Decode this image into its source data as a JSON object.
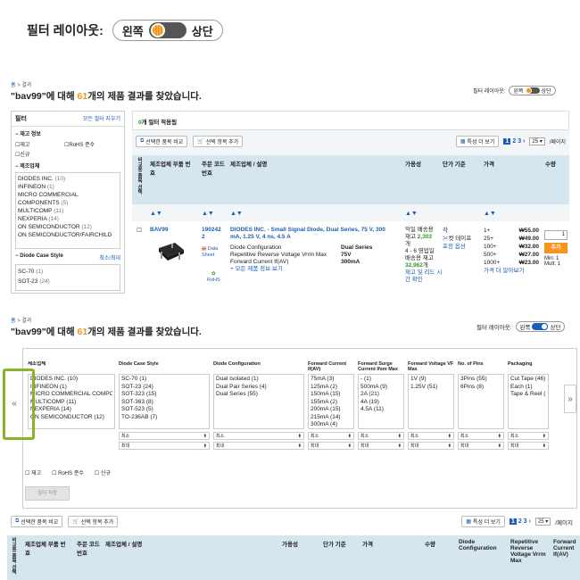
{
  "top_toggle": {
    "label": "필터 레이아웃:",
    "left": "왼쪽",
    "right": "상단"
  },
  "section1": {
    "breadcrumb": {
      "home": "홈",
      "sep": ">",
      "current": "결과"
    },
    "heading": {
      "pre": "\"bav99\"에 대해 ",
      "count": "61",
      "post": "개의 제품 결과를 찾았습니다."
    },
    "layout_toggle": {
      "label": "필터 레이아웃:",
      "left": "왼쪽",
      "right": "상단"
    },
    "filter_panel": {
      "title": "필터",
      "clear_all": "모든 필터 지우기",
      "stock_title": "재고 정보",
      "checks": [
        "재고",
        "RoHS 준수",
        "신규"
      ],
      "mfr_title": "제조업체",
      "manufacturers": [
        {
          "name": "DIODES INC.",
          "count": "(10)"
        },
        {
          "name": "INFINEON",
          "count": "(1)"
        },
        {
          "name": "MICRO COMMERCIAL COMPONENTS",
          "count": "(5)"
        },
        {
          "name": "MULTICOMP",
          "count": "(11)"
        },
        {
          "name": "NEXPERIA",
          "count": "(14)"
        },
        {
          "name": "ON SEMICONDUCTOR",
          "count": "(12)"
        },
        {
          "name": "ON SEMICONDUCTOR/FAIRCHILD",
          "count": ""
        }
      ],
      "case_title": "Diode Case Style",
      "case_minmax": "최소/최대",
      "cases": [
        {
          "name": "SC-70",
          "count": "(1)"
        },
        {
          "name": "SOT-23",
          "count": "(24)"
        }
      ]
    },
    "applied": {
      "count": "0",
      "text": "개 필터 적용됨"
    },
    "compare_btn": "선택한 품목 비교",
    "cart_btn": "선택 항목 추가",
    "more_attr_btn": "특성 더 보기",
    "pages": [
      "1",
      "2",
      "3"
    ],
    "next": "›",
    "per_page": "25",
    "per_page_suffix": "/페이지",
    "cols": {
      "compare": "비교용 품목 선택",
      "mfr_part": "제조업체 부품 번호",
      "order_code": "주문 코드 번호",
      "mfr_desc": "제조업체 / 설명",
      "availability": "가용성",
      "price_basis": "단가 기준",
      "price": "가격",
      "qty": "수량"
    },
    "product": {
      "part": "BAV99",
      "order": "1902422",
      "datasheet": "Data Sheet",
      "rohs": "RoHS",
      "title": "DIODES INC. - Small Signal Diode, Dual Series, 75 V, 300 mA, 1.25 V, 4 ns, 4.5 A",
      "specs": [
        {
          "k": "Diode Configuration",
          "v": "Dual Series"
        },
        {
          "k": "Repetitive Reverse Voltage Vrrm Max",
          "v": "75V"
        },
        {
          "k": "Forward Current If(AV)",
          "v": "300mA"
        }
      ],
      "more_specs": "+ 모든 제품 정보 보기",
      "avail_line1": "익일 배송용",
      "avail_stock_pre": "재고 ",
      "avail_stock": "2,303",
      "avail_unit": "개",
      "avail_line3": "4 - 6 영업일",
      "avail_line4": "배송용 재고",
      "avail_stock2": "32,962",
      "avail_unit2": "개",
      "avail_lead": "제고 및 리드 시간 확인",
      "basis": "각",
      "basis2": "컷 테이프",
      "pack_opt": "포장 옵션",
      "tiers": [
        {
          "q": "1+",
          "p": "₩55.00"
        },
        {
          "q": "25+",
          "p": "₩49.00"
        },
        {
          "q": "100+",
          "p": "₩32.00"
        },
        {
          "q": "500+",
          "p": "₩27.00"
        },
        {
          "q": "1000+",
          "p": "₩23.00"
        }
      ],
      "price_more": "가격 더 알아보기",
      "qty_value": "1",
      "add_btn": "추가",
      "min": "Min: 1",
      "mult": "Mult: 1"
    }
  },
  "section2": {
    "breadcrumb": {
      "home": "홈",
      "sep": ">",
      "current": "결과"
    },
    "heading": {
      "pre": "\"bav99\"에 대해 ",
      "count": "61",
      "post": "개의 제품 결과를 찾았습니다."
    },
    "layout_toggle": {
      "label": "필터 레이아웃:",
      "left": "왼쪽",
      "right": "상단"
    },
    "filter_cols": [
      {
        "title": "제조업체",
        "items": [
          "DIODES INC. (10)",
          "INFINEON (1)",
          "MICRO COMMERCIAL COMPONENTS (5)",
          "MULTICOMP (11)",
          "NEXPERIA (14)",
          "ON SEMICONDUCTOR (12)"
        ],
        "minmax": false
      },
      {
        "title": "Diode Case Style",
        "items": [
          "SC-70 (1)",
          "SOT-23 (24)",
          "SOT-323 (15)",
          "SOT-363 (8)",
          "SOT-523 (5)",
          "TO-236AB (7)"
        ],
        "minmax": true
      },
      {
        "title": "Diode Configuration",
        "items": [
          "Dual Isolated (1)",
          "Dual Pair Series (4)",
          "Dual Series (55)"
        ],
        "minmax": true
      },
      {
        "title": "Forward Current If(AV)",
        "items": [
          "75mA (3)",
          "125mA (2)",
          "150mA (15)",
          "155mA (2)",
          "200mA (15)",
          "215mA (14)",
          "300mA (4)"
        ],
        "minmax": true
      },
      {
        "title": "Forward Surge Current Ifsm Max",
        "items": [
          "- (1)",
          "500mA (9)",
          "2A (21)",
          "4A (19)",
          "4.5A (11)"
        ],
        "minmax": true
      },
      {
        "title": "Forward Voltage VF Max",
        "items": [
          "1V (9)",
          "1.25V (51)"
        ],
        "minmax": true
      },
      {
        "title": "No. of Pins",
        "items": [
          "3Pins (55)",
          "6Pins (8)"
        ],
        "minmax": true
      },
      {
        "title": "Packaging",
        "items": [
          "Cut Tape (46)",
          "Each (1)",
          "Tape & Reel (1"
        ],
        "minmax": true
      }
    ],
    "min_label": "최소",
    "max_label": "최대",
    "checks": [
      "재고",
      "RoHS 준수",
      "신규"
    ],
    "apply_btn": "필터 적용",
    "compare_btn": "선택한 품목 비교",
    "cart_btn": "선택 항목 추가",
    "more_attr_btn": "특성 더 보기",
    "pages": [
      "1",
      "2",
      "3"
    ],
    "next": "›",
    "per_page": "25",
    "per_page_suffix": "/페이지",
    "cols": {
      "compare": "비교용 품목 선택",
      "mfr_part": "제조업체 부품 번호",
      "order_code": "주문 코드 번호",
      "mfr_desc": "제조업체 / 설명",
      "availability": "가용성",
      "price_basis": "단가 기준",
      "price": "가격",
      "qty": "수량",
      "diode_config": "Diode Configuration",
      "vrrm": "Repetitive Reverse Voltage Vrrm Max",
      "if_av": "Forward Current If(AV)"
    }
  }
}
